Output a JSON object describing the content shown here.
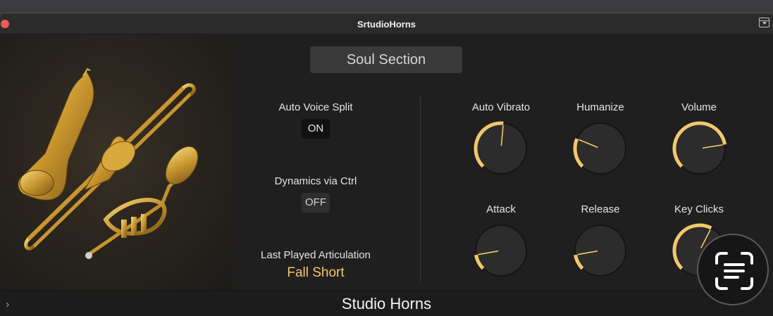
{
  "window": {
    "title": "SrtudioHorns"
  },
  "preset": {
    "name": "Soul Section"
  },
  "left_controls": {
    "auto_voice_split": {
      "label": "Auto Voice Split",
      "value": "ON"
    },
    "dynamics_via_ctrl": {
      "label": "Dynamics via Ctrl",
      "value": "OFF"
    },
    "last_played": {
      "label": "Last Played Articulation",
      "value": "Fall Short"
    }
  },
  "knobs": [
    {
      "label": "Auto Vibrato",
      "value": 0.52
    },
    {
      "label": "Humanize",
      "value": 0.25
    },
    {
      "label": "Volume",
      "value": 0.8
    },
    {
      "label": "Attack",
      "value": 0.13
    },
    {
      "label": "Release",
      "value": 0.13
    },
    {
      "label": "Key Clicks",
      "value": 0.6
    }
  ],
  "colors": {
    "accent": "#f2c86a",
    "knob_body": "#2c2c2c",
    "panel": "#1f1f1f"
  },
  "footer": {
    "title": "Studio Horns"
  },
  "icons": {
    "close": "close-dot-icon",
    "download": "download-icon",
    "expand": "chevron-right-icon",
    "scan": "text-scan-icon"
  }
}
